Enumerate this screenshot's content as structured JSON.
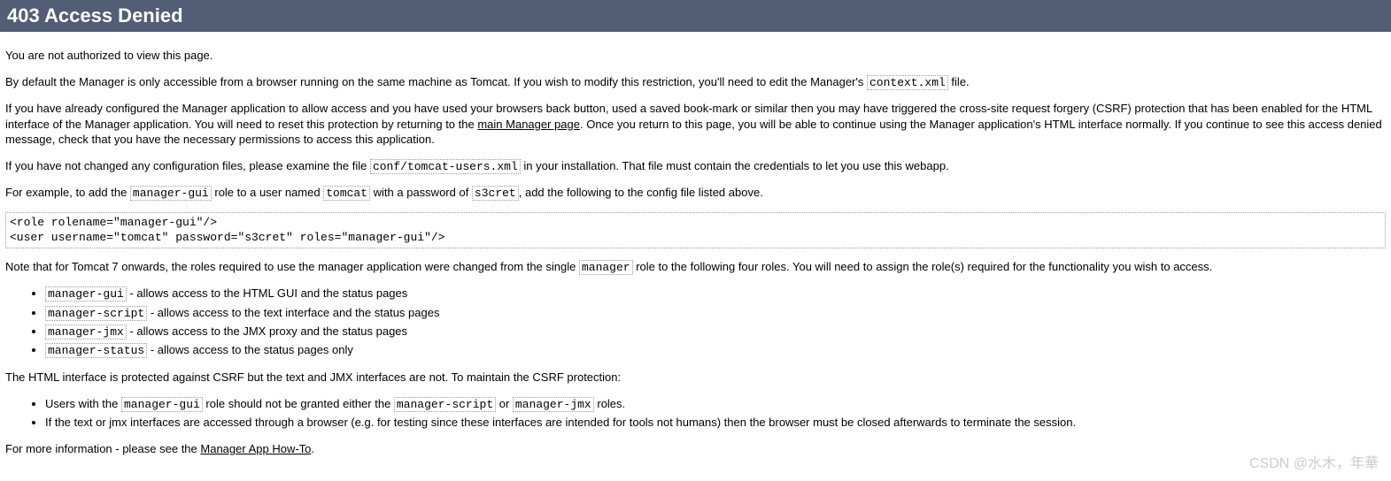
{
  "title": "403 Access Denied",
  "p1": "You are not authorized to view this page.",
  "p2_a": "By default the Manager is only accessible from a browser running on the same machine as Tomcat. If you wish to modify this restriction, you'll need to edit the Manager's ",
  "p2_code": "context.xml",
  "p2_b": " file.",
  "p3_a": "If you have already configured the Manager application to allow access and you have used your browsers back button, used a saved book-mark or similar then you may have triggered the cross-site request forgery (CSRF) protection that has been enabled for the HTML interface of the Manager application. You will need to reset this protection by returning to the ",
  "p3_link": "main Manager page",
  "p3_b": ". Once you return to this page, you will be able to continue using the Manager application's HTML interface normally. If you continue to see this access denied message, check that you have the necessary permissions to access this application.",
  "p4_a": "If you have not changed any configuration files, please examine the file ",
  "p4_code": "conf/tomcat-users.xml",
  "p4_b": " in your installation. That file must contain the credentials to let you use this webapp.",
  "p5_a": "For example, to add the ",
  "p5_code1": "manager-gui",
  "p5_b": " role to a user named ",
  "p5_code2": "tomcat",
  "p5_c": " with a password of ",
  "p5_code3": "s3cret",
  "p5_d": ", add the following to the config file listed above.",
  "pre": "<role rolename=\"manager-gui\"/>\n<user username=\"tomcat\" password=\"s3cret\" roles=\"manager-gui\"/>",
  "p6_a": "Note that for Tomcat 7 onwards, the roles required to use the manager application were changed from the single ",
  "p6_code": "manager",
  "p6_b": " role to the following four roles. You will need to assign the role(s) required for the functionality you wish to access.",
  "roles": [
    {
      "name": "manager-gui",
      "desc": " - allows access to the HTML GUI and the status pages"
    },
    {
      "name": "manager-script",
      "desc": " - allows access to the text interface and the status pages"
    },
    {
      "name": "manager-jmx",
      "desc": " - allows access to the JMX proxy and the status pages"
    },
    {
      "name": "manager-status",
      "desc": " - allows access to the status pages only"
    }
  ],
  "p7": "The HTML interface is protected against CSRF but the text and JMX interfaces are not. To maintain the CSRF protection:",
  "csrf": {
    "item1_a": "Users with the ",
    "item1_code1": "manager-gui",
    "item1_b": " role should not be granted either the ",
    "item1_code2": "manager-script",
    "item1_c": " or ",
    "item1_code3": "manager-jmx",
    "item1_d": " roles.",
    "item2": "If the text or jmx interfaces are accessed through a browser (e.g. for testing since these interfaces are intended for tools not humans) then the browser must be closed afterwards to terminate the session."
  },
  "p8_a": "For more information - please see the ",
  "p8_link": "Manager App How-To",
  "p8_b": ".",
  "watermark": "CSDN @水木，年華"
}
